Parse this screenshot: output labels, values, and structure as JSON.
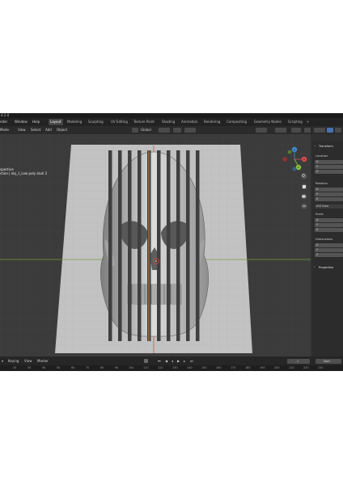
{
  "app": {
    "title": "4.2.0",
    "menu": [
      "nder",
      "Window",
      "Help"
    ],
    "workspaces": [
      "Layout",
      "Modeling",
      "Sculpting",
      "UV Editing",
      "Texture Paint",
      "Shading",
      "Animation",
      "Rendering",
      "Compositing",
      "Geometry Nodes",
      "Scripting",
      "+"
    ],
    "active_workspace": "Layout"
  },
  "header": {
    "mode": "Mode",
    "menu": [
      "View",
      "Select",
      "Add",
      "Object"
    ],
    "orientation": "Global"
  },
  "viewport": {
    "overlay_line1": "spective",
    "overlay_line2": "ction | obj_1_Low poly skull 2"
  },
  "gizmo": {
    "x_label": "X",
    "y_label": "Y",
    "z_label": "Z",
    "colors": {
      "x": "#e04b4b",
      "y": "#8bc43f",
      "z": "#3f8fd6",
      "neg_x": "#8a3434",
      "neg_y": "#5a7a32",
      "neg_z": "#2f5f8f"
    }
  },
  "npanel": {
    "section_transform": "Transform",
    "location": "Location",
    "loc_axes": [
      "X",
      "Y",
      "Z"
    ],
    "rotation": "Rotation",
    "rot_axes": [
      "X",
      "Y",
      "Z"
    ],
    "rotation_mode": "XYZ Euler",
    "scale": "Scale",
    "scale_axes": [
      "X",
      "Y",
      "Z"
    ],
    "dimensions": "Dimensions",
    "dim_axes": [
      "X",
      "Y",
      "Z"
    ],
    "section_properties": "Properties"
  },
  "timeline": {
    "menu": [
      "Keying",
      "View",
      "Marker"
    ],
    "current_frame": "1",
    "start_label": "Start"
  },
  "ruler": [
    "20",
    "30",
    "40",
    "50",
    "60",
    "70",
    "80",
    "90",
    "100",
    "110",
    "120",
    "130",
    "140",
    "150",
    "160",
    "170",
    "180",
    "190",
    "200",
    "210",
    "220",
    "230"
  ],
  "colors": {
    "accent": "#4772b3",
    "origin": "#f09a30",
    "red_axis": "#b43c3c",
    "green_axis": "#6f9a2f"
  }
}
